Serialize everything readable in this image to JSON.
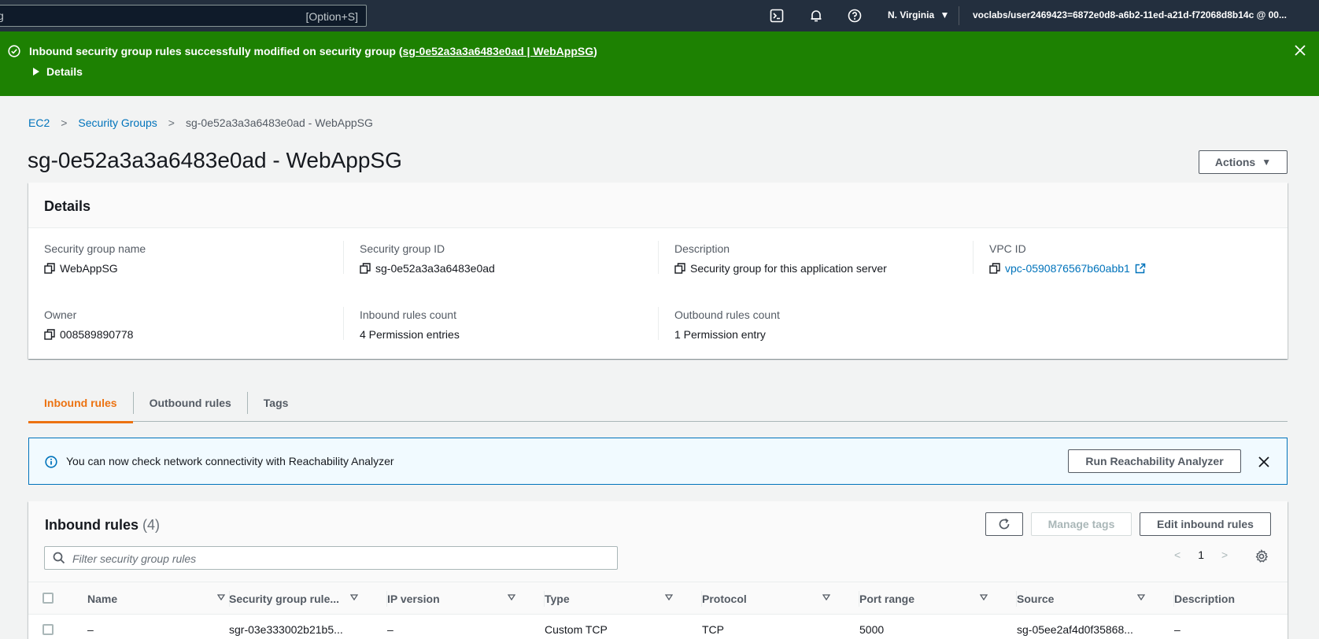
{
  "topnav": {
    "search_shortcut": "[Option+S]",
    "region": "N. Virginia",
    "account": "voclabs/user2469423=6872e0d8-a6b2-11ed-a21d-f72068d8b14c @ 00..."
  },
  "flash": {
    "message_prefix": "Inbound security group rules successfully modified on security group (",
    "message_link": "sg-0e52a3a3a6483e0ad | WebAppSG",
    "message_suffix": ")",
    "details_label": "Details"
  },
  "breadcrumb": {
    "items": [
      "EC2",
      "Security Groups"
    ],
    "current": "sg-0e52a3a3a6483e0ad - WebAppSG"
  },
  "page": {
    "title": "sg-0e52a3a3a6483e0ad - WebAppSG",
    "actions_label": "Actions"
  },
  "details": {
    "header": "Details",
    "fields": [
      {
        "label": "Security group name",
        "value": "WebAppSG"
      },
      {
        "label": "Security group ID",
        "value": "sg-0e52a3a3a6483e0ad"
      },
      {
        "label": "Description",
        "value": "Security group for this application server"
      },
      {
        "label": "VPC ID",
        "value": "vpc-0590876567b60abb1"
      },
      {
        "label": "Owner",
        "value": "008589890778"
      },
      {
        "label": "Inbound rules count",
        "value": "4 Permission entries"
      },
      {
        "label": "Outbound rules count",
        "value": "1 Permission entry"
      }
    ]
  },
  "tabs": [
    "Inbound rules",
    "Outbound rules",
    "Tags"
  ],
  "info_alert": {
    "text": "You can now check network connectivity with Reachability Analyzer",
    "button": "Run Reachability Analyzer"
  },
  "rules": {
    "title": "Inbound rules",
    "count": "(4)",
    "manage_tags": "Manage tags",
    "edit_rules": "Edit inbound rules",
    "filter_placeholder": "Filter security group rules",
    "page": "1",
    "columns": [
      "Name",
      "Security group rule...",
      "IP version",
      "Type",
      "Protocol",
      "Port range",
      "Source",
      "Description"
    ],
    "rows": [
      [
        "–",
        "sgr-03e333002b21b5...",
        "–",
        "Custom TCP",
        "TCP",
        "5000",
        "sg-05ee2af4d0f35868...",
        "–"
      ]
    ]
  }
}
